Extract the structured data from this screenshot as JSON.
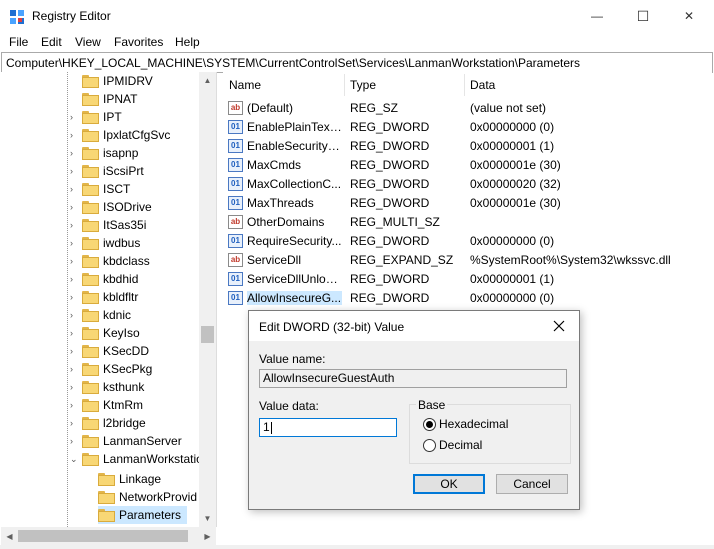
{
  "window": {
    "title": "Registry Editor",
    "minimize_glyph": "—",
    "maximize_glyph": "☐",
    "close_glyph": "✕"
  },
  "menu": [
    "File",
    "Edit",
    "View",
    "Favorites",
    "Help"
  ],
  "address": "Computer\\HKEY_LOCAL_MACHINE\\SYSTEM\\CurrentControlSet\\Services\\LanmanWorkstation\\Parameters",
  "tree": {
    "items": [
      {
        "label": "IPMIDRV",
        "expander": ""
      },
      {
        "label": "IPNAT",
        "expander": ""
      },
      {
        "label": "IPT",
        "expander": "›"
      },
      {
        "label": "IpxlatCfgSvc",
        "expander": "›"
      },
      {
        "label": "isapnp",
        "expander": "›"
      },
      {
        "label": "iScsiPrt",
        "expander": "›"
      },
      {
        "label": "ISCT",
        "expander": "›"
      },
      {
        "label": "ISODrive",
        "expander": "›"
      },
      {
        "label": "ItSas35i",
        "expander": "›"
      },
      {
        "label": "iwdbus",
        "expander": "›"
      },
      {
        "label": "kbdclass",
        "expander": "›"
      },
      {
        "label": "kbdhid",
        "expander": "›"
      },
      {
        "label": "kbldfltr",
        "expander": "›"
      },
      {
        "label": "kdnic",
        "expander": "›"
      },
      {
        "label": "KeyIso",
        "expander": "›"
      },
      {
        "label": "KSecDD",
        "expander": "›"
      },
      {
        "label": "KSecPkg",
        "expander": "›"
      },
      {
        "label": "ksthunk",
        "expander": "›"
      },
      {
        "label": "KtmRm",
        "expander": "›"
      },
      {
        "label": "l2bridge",
        "expander": "›"
      },
      {
        "label": "LanmanServer",
        "expander": "›"
      },
      {
        "label": "LanmanWorkstatio",
        "expander": "⌄"
      }
    ],
    "children": [
      {
        "label": "Linkage"
      },
      {
        "label": "NetworkProvid"
      },
      {
        "label": "Parameters"
      }
    ]
  },
  "values": {
    "headers": {
      "name": "Name",
      "type": "Type",
      "data": "Data"
    },
    "rows": [
      {
        "icon": "ab",
        "name": "(Default)",
        "type": "REG_SZ",
        "data": "(value not set)"
      },
      {
        "icon": "bin",
        "name": "EnablePlainText...",
        "type": "REG_DWORD",
        "data": "0x00000000 (0)"
      },
      {
        "icon": "bin",
        "name": "EnableSecuritySi...",
        "type": "REG_DWORD",
        "data": "0x00000001 (1)"
      },
      {
        "icon": "bin",
        "name": "MaxCmds",
        "type": "REG_DWORD",
        "data": "0x0000001e (30)"
      },
      {
        "icon": "bin",
        "name": "MaxCollectionC...",
        "type": "REG_DWORD",
        "data": "0x00000020 (32)"
      },
      {
        "icon": "bin",
        "name": "MaxThreads",
        "type": "REG_DWORD",
        "data": "0x0000001e (30)"
      },
      {
        "icon": "ab",
        "name": "OtherDomains",
        "type": "REG_MULTI_SZ",
        "data": ""
      },
      {
        "icon": "bin",
        "name": "RequireSecurity...",
        "type": "REG_DWORD",
        "data": "0x00000000 (0)"
      },
      {
        "icon": "ab",
        "name": "ServiceDll",
        "type": "REG_EXPAND_SZ",
        "data": "%SystemRoot%\\System32\\wkssvc.dll"
      },
      {
        "icon": "bin",
        "name": "ServiceDllUnloa...",
        "type": "REG_DWORD",
        "data": "0x00000001 (1)"
      },
      {
        "icon": "bin",
        "name": "AllowInsecureG...",
        "type": "REG_DWORD",
        "data": "0x00000000 (0)"
      }
    ]
  },
  "dialog": {
    "title": "Edit DWORD (32-bit) Value",
    "value_name_label": "Value name:",
    "value_name": "AllowInsecureGuestAuth",
    "value_data_label": "Value data:",
    "value_data": "1",
    "base_label": "Base",
    "hex_label": "Hexadecimal",
    "dec_label": "Decimal",
    "base_selected": "Hexadecimal",
    "ok_label": "OK",
    "cancel_label": "Cancel"
  }
}
